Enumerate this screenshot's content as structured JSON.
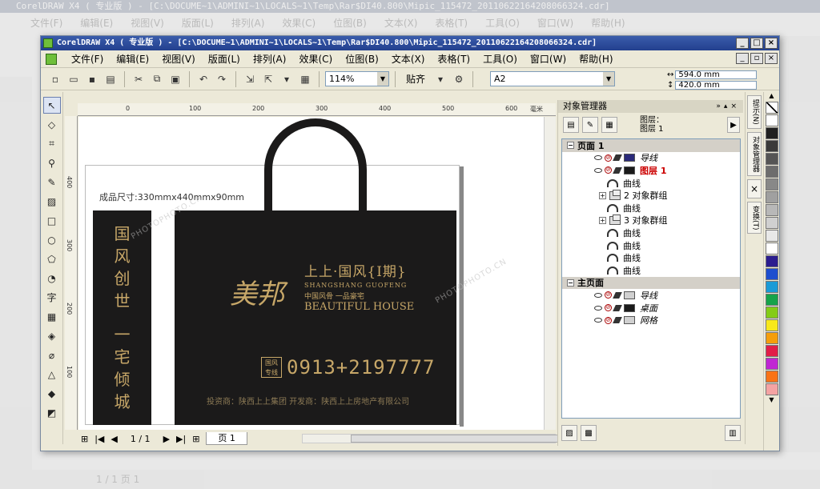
{
  "bg_title": "CorelDRAW X4 ( 专业版 ) - [C:\\DOCUME~1\\ADMINI~1\\LOCALS~1\\Temp\\Rar$DI40.800\\Mipic_115472_20110622164208066324.cdr]",
  "bg_menu": [
    "文件(F)",
    "编辑(E)",
    "视图(V)",
    "版面(L)",
    "排列(A)",
    "效果(C)",
    "位图(B)",
    "文本(X)",
    "表格(T)",
    "工具(O)",
    "窗口(W)",
    "帮助(H)"
  ],
  "bg_status": "1 / 1   页 1",
  "window": {
    "title": "CorelDRAW X4 ( 专业版 ) - [C:\\DOCUME~1\\ADMINI~1\\LOCALS~1\\Temp\\Rar$DI40.800\\Mipic_115472_20110622164208066324.cdr]",
    "min": "_",
    "max": "□",
    "close": "×",
    "restore": "▫"
  },
  "menu": [
    "文件(F)",
    "编辑(E)",
    "视图(V)",
    "版面(L)",
    "排列(A)",
    "效果(C)",
    "位图(B)",
    "文本(X)",
    "表格(T)",
    "工具(O)",
    "窗口(W)",
    "帮助(H)"
  ],
  "toolbar": {
    "zoom": "114%",
    "snap": "贴齐",
    "page_size": "A2",
    "width": "594.0 mm",
    "height": "420.0 mm"
  },
  "ruler": {
    "unit": "毫米",
    "h_ticks": [
      "0",
      "100",
      "200",
      "300",
      "400",
      "500",
      "600"
    ],
    "v_ticks": [
      "400",
      "300",
      "200",
      "100"
    ]
  },
  "docker": {
    "title": "对象管理器",
    "layer_label": "图层：",
    "layer_name": "图层 1",
    "tree": [
      {
        "type": "hdr",
        "label": "页面 1"
      },
      {
        "type": "layer",
        "label": "导线",
        "swatch": "#2a2a7a",
        "italic": true
      },
      {
        "type": "layer",
        "label": "图层 1",
        "swatch": "#1a1a1a",
        "red": true
      },
      {
        "type": "item",
        "label": "曲线",
        "indent": 3
      },
      {
        "type": "group",
        "label": "2 对象群组",
        "indent": 2
      },
      {
        "type": "item",
        "label": "曲线",
        "indent": 3
      },
      {
        "type": "group",
        "label": "3 对象群组",
        "indent": 2
      },
      {
        "type": "item",
        "label": "曲线",
        "indent": 3
      },
      {
        "type": "item",
        "label": "曲线",
        "indent": 3
      },
      {
        "type": "item",
        "label": "曲线",
        "indent": 3
      },
      {
        "type": "item",
        "label": "曲线",
        "indent": 3
      },
      {
        "type": "hdr",
        "label": "主页面"
      },
      {
        "type": "layer",
        "label": "导线",
        "swatch": "#d0d0d0",
        "italic": true
      },
      {
        "type": "layer",
        "label": "桌面",
        "swatch": "#1a1a1a",
        "italic": true
      },
      {
        "type": "layer",
        "label": "网格",
        "swatch": "#d0d0d0",
        "italic": true
      }
    ]
  },
  "side_tabs": [
    "提示(N)",
    "对象管理器",
    "变换(T)"
  ],
  "palette": [
    "#ffffff",
    "#202020",
    "#3a3a3a",
    "#555555",
    "#6d6d6d",
    "#888888",
    "#a0a0a0",
    "#b8b8b8",
    "#d0d0d0",
    "#e8e8e8",
    "#ffffff",
    "#2b1d8f",
    "#1d4ecf",
    "#1a9bd7",
    "#16a34a",
    "#84cc16",
    "#f7e81a",
    "#f59e0b",
    "#e11d48",
    "#c026d3",
    "#f97316",
    "#f4a3a3"
  ],
  "status": {
    "page_counter": "1 / 1",
    "page_tab": "页 1"
  },
  "artwork": {
    "size_label": "成品尺寸:330mmx440mmx90mm",
    "vertical_text": [
      "国",
      "风",
      "创",
      "世",
      "",
      "一",
      "宅",
      "倾",
      "城"
    ],
    "logo_text": "美邦",
    "brand_cn": "上上·国风{Ⅰ期}",
    "brand_pinyin": "SHANGSHANG GUOFENG",
    "brand_sub": "中国风骨  一品豪宅",
    "brand_en": "BEAUTIFUL HOUSE",
    "badge": "国风 专线",
    "phone": "0913+2197777",
    "developer": "投资商：陕西上上集团    开发商：陕西上上房地产有限公司"
  },
  "watermark": "PHOTOPHOTO.CN"
}
